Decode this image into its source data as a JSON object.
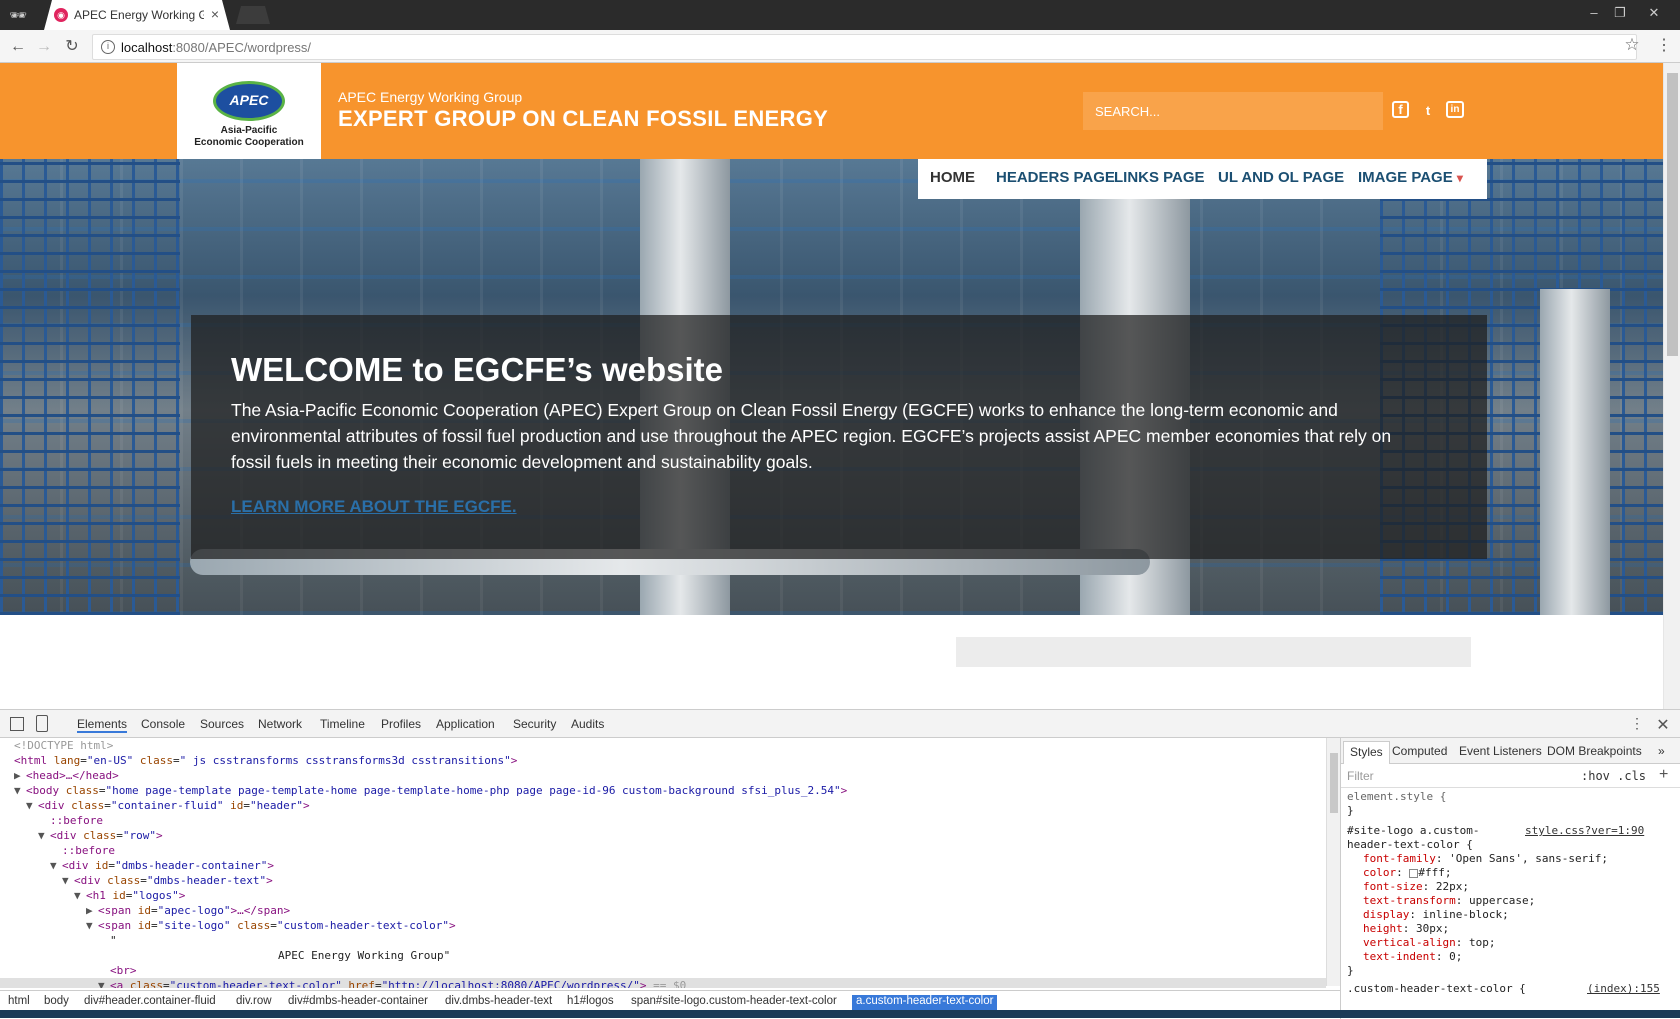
{
  "browser": {
    "tab_title": "APEC Energy Working Gr",
    "url_host": "localhost",
    "url_rest": ":8080/APEC/wordpress/",
    "window_controls": [
      "–",
      "❐",
      "✕"
    ],
    "icons": {
      "back": "back-arrow-icon",
      "forward": "forward-arrow-icon",
      "reload": "reload-icon",
      "star": "bookmark-star-icon",
      "menu": "kebab-menu-icon"
    }
  },
  "site": {
    "logo_text": "APEC",
    "logo_line1": "Asia-Pacific",
    "logo_line2": "Economic Cooperation",
    "subtitle": "APEC Energy Working Group",
    "title": "EXPERT GROUP ON CLEAN FOSSIL ENERGY",
    "search_placeholder": "SEARCH...",
    "social": [
      "f",
      "t",
      "in"
    ],
    "colors": {
      "header": "#f7942d",
      "nav_text": "#1b4f72",
      "link": "#2a6fa8"
    }
  },
  "nav": {
    "items": [
      "HOME",
      "HEADERS PAGE",
      "LINKS PAGE",
      "UL AND OL PAGE",
      "IMAGE PAGE"
    ],
    "dropdown_marker": "▾"
  },
  "hero": {
    "title": "WELCOME to EGCFE’s website",
    "body": "The Asia-Pacific Economic Cooperation (APEC) Expert Group on Clean Fossil Energy (EGCFE) works to enhance the long-term economic and environmental attributes of fossil fuel production and use throughout the APEC region. EGCFE’s projects assist APEC member economies that rely on fossil fuels in meeting their economic development and sustainability goals.",
    "link": "LEARN MORE ABOUT THE EGCFE."
  },
  "devtools": {
    "tabs": [
      "Elements",
      "Console",
      "Sources",
      "Network",
      "Timeline",
      "Profiles",
      "Application",
      "Security",
      "Audits"
    ],
    "dom": {
      "doctype": "<!DOCTYPE html>",
      "html_open_a": "<html ",
      "html_lang_attr": "lang",
      "html_lang_val": "\"en-US\"",
      "html_class_attr": " class",
      "html_class_val": "\" js csstransforms csstransforms3d csstransitions\"",
      "html_close": ">",
      "head": "<head>…</head>",
      "body_tag": "<body ",
      "body_class_attr": "class",
      "body_class_val": "\"home page-template page-template-home page-template-home-php page page-id-96 custom-background sfsi_plus_2.54\"",
      "body_close": ">",
      "div1_tag": "<div ",
      "div1_class": "class",
      "div1_class_val": "\"container-fluid\"",
      "div1_id": " id",
      "div1_id_val": "\"header\"",
      "div1_close": ">",
      "before": "::before",
      "div_row_tag": "<div ",
      "div_row_class": "class",
      "div_row_class_val": "\"row\"",
      "div_row_close": ">",
      "div_hc_tag": "<div ",
      "div_hc_id": "id",
      "div_hc_id_val": "\"dmbs-header-container\"",
      "div_hc_close": ">",
      "div_ht_tag": "<div ",
      "div_ht_class": "class",
      "div_ht_class_val": "\"dmbs-header-text\"",
      "div_ht_close": ">",
      "h1_tag": "<h1 ",
      "h1_id": "id",
      "h1_id_val": "\"logos\"",
      "h1_close": ">",
      "span1_tag": "<span ",
      "span1_id": "id",
      "span1_id_val": "\"apec-logo\"",
      "span1_close": ">…</span>",
      "span2_tag": "<span ",
      "span2_id": "id",
      "span2_id_val": "\"site-logo\"",
      "span2_class": " class",
      "span2_class_val": "\"custom-header-text-color\"",
      "span2_close": ">",
      "quote": "\"",
      "text_node": "APEC Energy Working Group\"",
      "br": "<br>",
      "a_tag": "<a ",
      "a_class": "class",
      "a_class_val": "\"custom-header-text-color\"",
      "a_href": " href",
      "a_href_val": "\"http://localhost:8080/APEC/wordpress/\"",
      "a_close": ">",
      "a_sel": " == $0"
    },
    "breadcrumbs": [
      "html",
      "body",
      "div#header.container-fluid",
      "div.row",
      "div#dmbs-header-container",
      "div.dmbs-header-text",
      "h1#logos",
      "span#site-logo.custom-header-text-color",
      "a.custom-header-text-color"
    ],
    "styles_tabs": [
      "Styles",
      "Computed",
      "Event Listeners",
      "DOM Breakpoints"
    ],
    "filter_placeholder": "Filter",
    "hov_cls": ":hov  .cls",
    "rules": {
      "element_style": "element.style {",
      "close": "}",
      "selector_a": "#site-logo a.custom-",
      "selector_b": "header-text-color {",
      "source": "style.css?ver=1:90",
      "props": [
        {
          "n": "font-family",
          "v": "'Open Sans', sans-serif;"
        },
        {
          "n": "color",
          "v": "#fff;"
        },
        {
          "n": "font-size",
          "v": "22px;"
        },
        {
          "n": "text-transform",
          "v": "uppercase;"
        },
        {
          "n": "display",
          "v": "inline-block;"
        },
        {
          "n": "height",
          "v": "30px;"
        },
        {
          "n": "vertical-align",
          "v": "top;"
        },
        {
          "n": "text-indent",
          "v": "0;"
        }
      ],
      "next_selector": ".custom-header-text-color {",
      "next_source": "(index):155"
    }
  }
}
